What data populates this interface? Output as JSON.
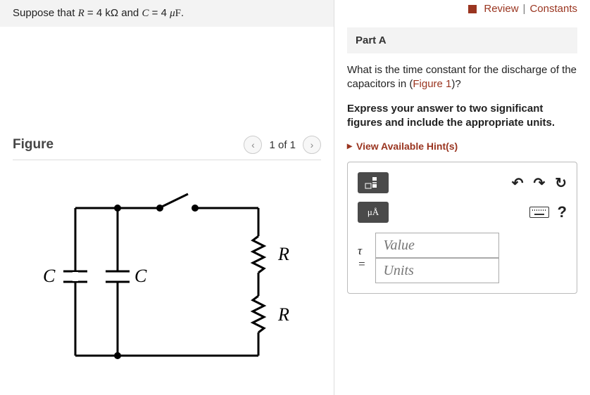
{
  "problem": {
    "prefix": "Suppose that ",
    "r_sym": "R",
    "r_val": " = 4 kΩ",
    "and": " and ",
    "c_sym": "C",
    "c_val": " = 4 ",
    "mu": "μ",
    "f": "F",
    "period": "."
  },
  "figure": {
    "title": "Figure",
    "pager": "1 of 1",
    "labels": {
      "C": "C",
      "R": "R"
    }
  },
  "top": {
    "review": "Review",
    "sep": " | ",
    "constants": "Constants"
  },
  "partA": {
    "heading": "Part A",
    "q1": "What is the time constant for the discharge of the capacitors in (",
    "figlink": "Figure 1",
    "q2": ")?",
    "instr": "Express your answer to two significant figures and include the appropriate units.",
    "hints": "View Available Hint(s)",
    "unit_btn": "μÅ",
    "tau": "τ",
    "eq": "=",
    "value_ph": "Value",
    "units_ph": "Units"
  }
}
